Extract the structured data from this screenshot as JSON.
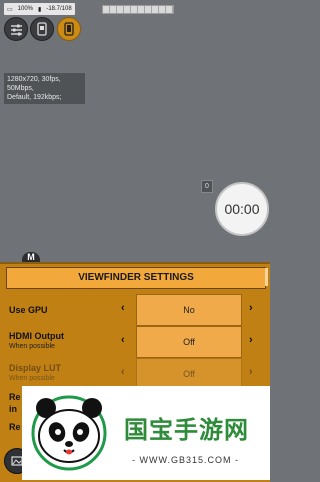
{
  "status_bar": {
    "battery": "100%",
    "storage": "-18.7/108"
  },
  "toolbar": {
    "icons": [
      "sliders-icon",
      "phone-camera-icon",
      "phone-orange-icon"
    ]
  },
  "info_box": {
    "line1": "1280x720, 30fps,",
    "line2": "50Mbps,",
    "line3": "Default, 192kbps;"
  },
  "overlay": {
    "zero_badge": "0",
    "timer": "00:00",
    "m_badge": "M"
  },
  "viewfinder_settings": {
    "title": "VIEWFINDER SETTINGS",
    "rows": [
      {
        "label": "Use GPU",
        "sub": "",
        "value": "No",
        "left": "‹",
        "right": "›"
      },
      {
        "label": "HDMI Output",
        "sub": "When possible",
        "value": "Off",
        "left": "‹",
        "right": "›"
      },
      {
        "label": "Display LUT",
        "sub": "When possible",
        "value": "Off",
        "left": "‹",
        "right": "›"
      }
    ],
    "partial_rows": [
      "Re",
      "in",
      "Re"
    ]
  },
  "watermark": {
    "brand": "国宝手游网",
    "url": "- WWW.GB315.COM -"
  },
  "colors": {
    "panel": "#c08014",
    "value_box": "#f1aa49",
    "active_icon": "#cc8b15"
  }
}
